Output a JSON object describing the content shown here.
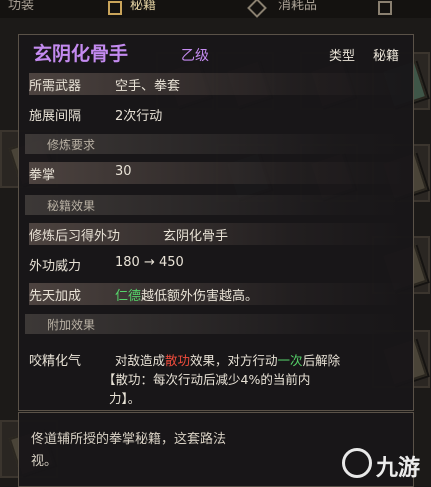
{
  "tabs": [
    {
      "label": "功装",
      "icon": "",
      "active": false
    },
    {
      "label": "秘籍",
      "icon": "book-icon",
      "active": true
    },
    {
      "label": "消耗品",
      "icon": "diamond-icon",
      "active": false
    },
    {
      "label": "",
      "icon": "arrow-icon",
      "active": false
    }
  ],
  "item": {
    "name": "玄阴化骨手",
    "grade": "乙级",
    "type_label": "类型",
    "type_value": "秘籍"
  },
  "stats": [
    {
      "key": "所需武器",
      "value": "空手、拳套"
    },
    {
      "key": "施展间隔",
      "value": "2次行动"
    }
  ],
  "sections": {
    "training": "修炼要求",
    "effects": "秘籍效果",
    "extra": "附加效果"
  },
  "requirement": {
    "key": "拳掌",
    "value": "30"
  },
  "learned": {
    "key": "修炼后习得外功",
    "value": "玄阴化骨手"
  },
  "power": {
    "key": "外功威力",
    "value": "180 → 450"
  },
  "innate": {
    "key": "先天加成",
    "highlight": "仁德",
    "text": "越低额外伤害越高。"
  },
  "extra_effect": {
    "key": "咬精化气",
    "line1_a": "对敌造成",
    "line1_red": "散功",
    "line1_b": "效果，对方行动",
    "line1_green": "一次",
    "line1_c": "后解除",
    "line2": "【散功：每次行动后减少4%的当前内",
    "line3": "力】。"
  },
  "description": "佟道辅所授的拳掌秘籍，这套路法",
  "description_line2": "视。",
  "watermark": "九游",
  "colors": {
    "purple": "#c48bf0",
    "green": "#56d36a",
    "red": "#ef4c3c",
    "gold_border": "#c9a45a"
  }
}
